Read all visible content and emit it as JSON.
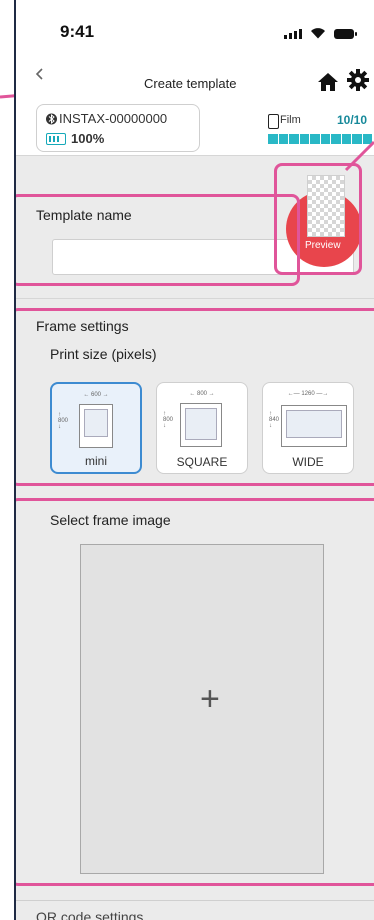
{
  "status_bar": {
    "time": "9:41"
  },
  "nav": {
    "title": "Create template"
  },
  "device": {
    "name": "INSTAX-00000000",
    "battery": "100%"
  },
  "film": {
    "label": "Film",
    "count": "10/10",
    "remaining": 10,
    "capacity": 10
  },
  "template_name": {
    "label": "Template name",
    "value": ""
  },
  "preview": {
    "label": "Preview"
  },
  "frame_settings": {
    "title": "Frame settings",
    "print_size_label": "Print size (pixels)",
    "sizes": [
      {
        "label": "mini",
        "width": "600",
        "height": "800",
        "selected": true
      },
      {
        "label": "SQUARE",
        "width": "800",
        "height": "800",
        "selected": false
      },
      {
        "label": "WIDE",
        "width": "1260",
        "height": "840",
        "selected": false
      }
    ]
  },
  "frame_image": {
    "label": "Select frame image",
    "add_symbol": "+"
  },
  "qr": {
    "label": "QR code settings"
  },
  "colors": {
    "highlight": "#e0559a",
    "accent": "#29b8c6",
    "preview": "#e8454c",
    "selected": "#3d8bd1"
  }
}
